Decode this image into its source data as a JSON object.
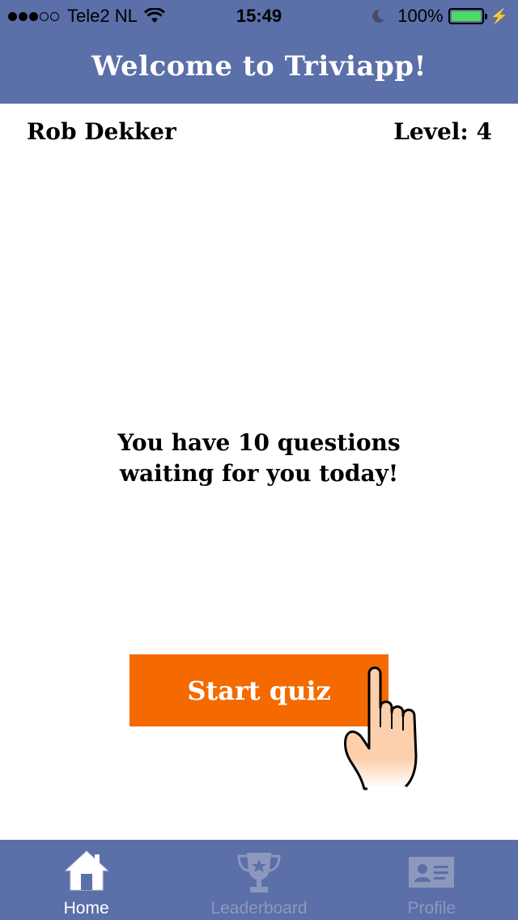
{
  "status_bar": {
    "carrier": "Tele2 NL",
    "time": "15:49",
    "battery_percent": "100%",
    "battery_level": 1.0,
    "signal_bars_filled": 3,
    "signal_bars_total": 5
  },
  "header": {
    "title": "Welcome to Triviapp!"
  },
  "user": {
    "name": "Rob Dekker",
    "level": "Level: 4"
  },
  "main": {
    "message_line1": "You have 10 questions",
    "message_line2": "waiting for you today!",
    "start_button_label": "Start quiz",
    "pointer_icon": "pointing-hand-icon"
  },
  "tabbar": {
    "tabs": [
      {
        "label": "Home",
        "icon": "home-icon",
        "active": true
      },
      {
        "label": "Leaderboard",
        "icon": "trophy-icon",
        "active": false
      },
      {
        "label": "Profile",
        "icon": "id-card-icon",
        "active": false
      }
    ]
  },
  "colors": {
    "header_bg": "#5b6fa8",
    "button_bg": "#f46a00",
    "battery": "#4cd964",
    "inactive_tab": "#8d98bd"
  }
}
